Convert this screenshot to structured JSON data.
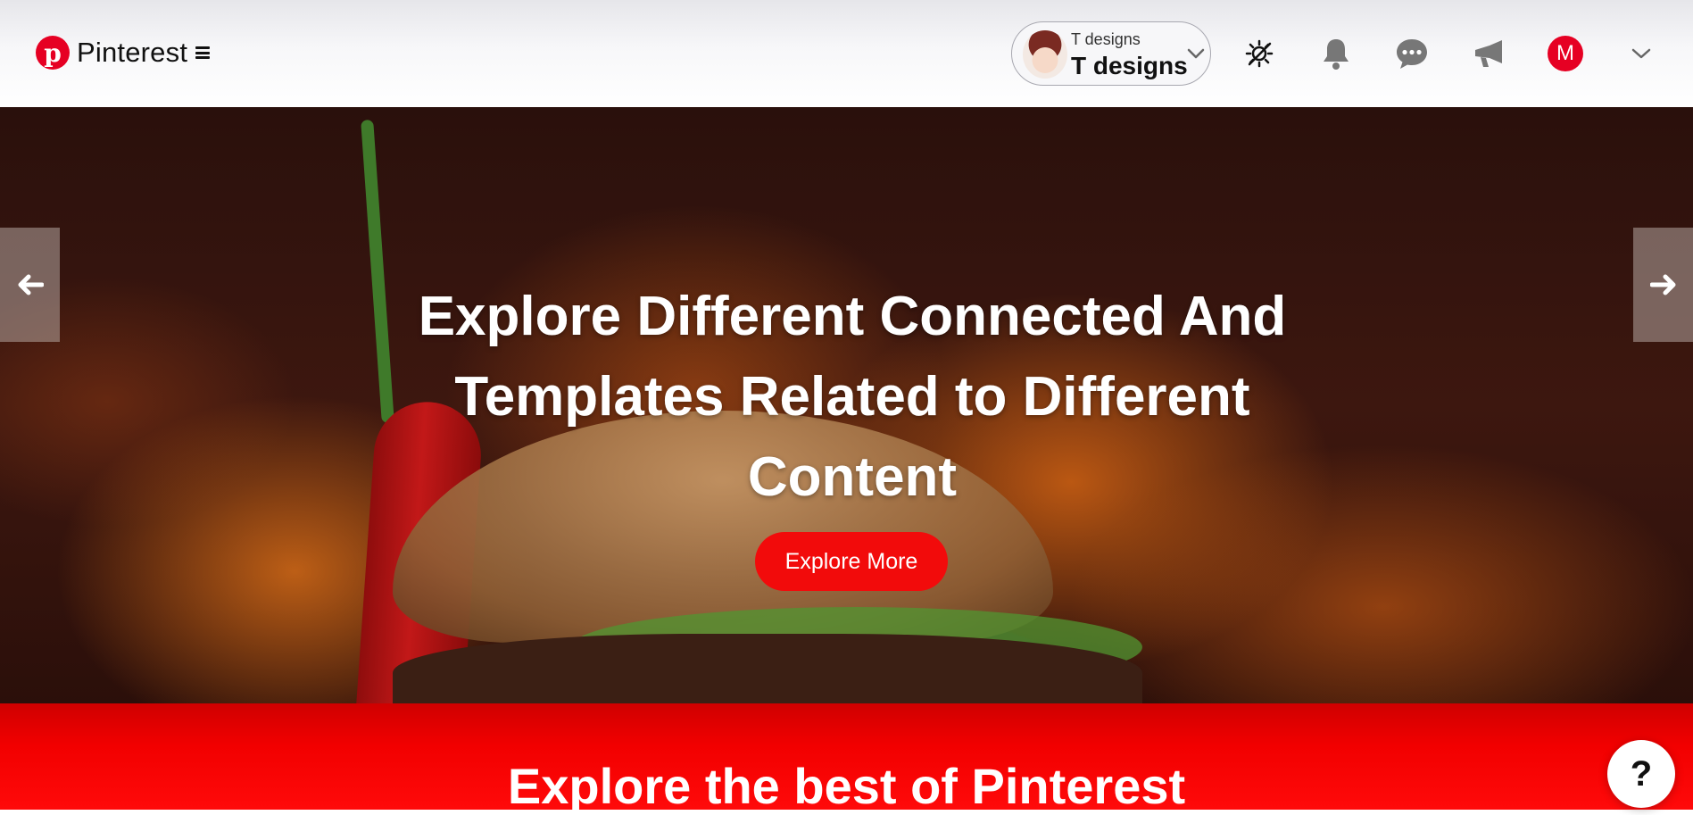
{
  "header": {
    "brand": "Pinterest",
    "account": {
      "small_label": "T designs",
      "name": "T designs"
    },
    "avatar_initial": "M",
    "icons": [
      "theme-toggle-icon",
      "bell-icon",
      "chat-icon",
      "megaphone-icon",
      "chevron-down-icon"
    ]
  },
  "hero": {
    "title": "Explore Different Connected And Templates Related to Different Content",
    "cta_label": "Explore More"
  },
  "band": {
    "title": "Explore the best of Pinterest"
  },
  "help": {
    "label": "?"
  },
  "colors": {
    "brand": "#e60023",
    "cta": "#f20b0b",
    "band": "#f20000"
  }
}
